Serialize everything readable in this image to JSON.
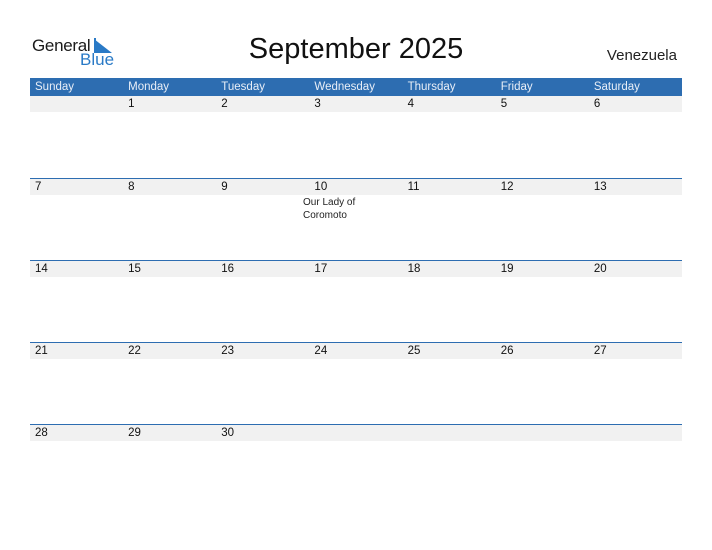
{
  "logo": {
    "word1": "General",
    "word2": "Blue"
  },
  "title": "September 2025",
  "country": "Venezuela",
  "weekdays": [
    "Sunday",
    "Monday",
    "Tuesday",
    "Wednesday",
    "Thursday",
    "Friday",
    "Saturday"
  ],
  "weeks": [
    {
      "days": [
        "",
        "1",
        "2",
        "3",
        "4",
        "5",
        "6"
      ],
      "events": [
        "",
        "",
        "",
        "",
        "",
        "",
        ""
      ]
    },
    {
      "days": [
        "7",
        "8",
        "9",
        "10",
        "11",
        "12",
        "13"
      ],
      "events": [
        "",
        "",
        "",
        "",
        "Our Lady of Coromoto",
        "",
        ""
      ]
    },
    {
      "days": [
        "14",
        "15",
        "16",
        "17",
        "18",
        "19",
        "20"
      ],
      "events": [
        "",
        "",
        "",
        "",
        "",
        "",
        ""
      ]
    },
    {
      "days": [
        "21",
        "22",
        "23",
        "24",
        "25",
        "26",
        "27"
      ],
      "events": [
        "",
        "",
        "",
        "",
        "",
        "",
        ""
      ]
    },
    {
      "days": [
        "28",
        "29",
        "30",
        "",
        "",
        "",
        ""
      ],
      "events": [
        "",
        "",
        "",
        "",
        "",
        "",
        ""
      ]
    }
  ],
  "colors": {
    "accent": "#2d6db1",
    "logo_blue": "#2a7ac6",
    "band": "#f1f1f1"
  }
}
